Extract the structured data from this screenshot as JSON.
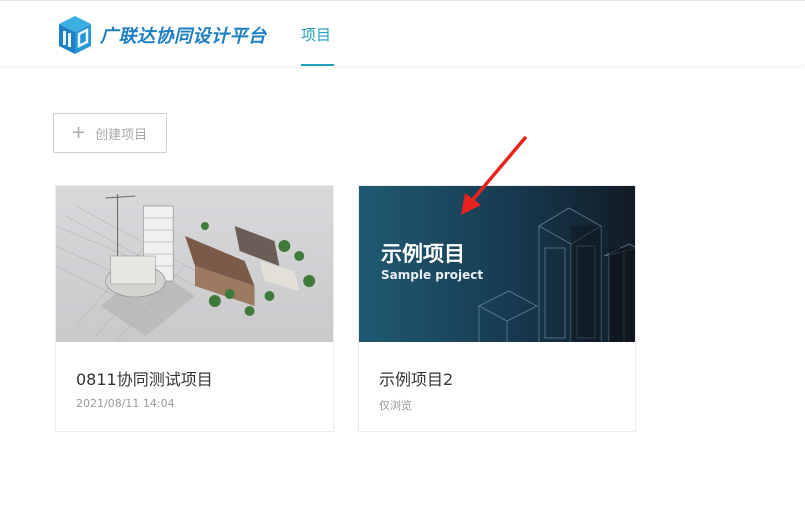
{
  "header": {
    "brand": "广联达协同设计平台",
    "nav_tab": "项目"
  },
  "toolbar": {
    "create_label": "创建项目"
  },
  "projects": [
    {
      "title": "0811协同测试项目",
      "meta": "2021/08/11 14:04"
    },
    {
      "title": "示例项目2",
      "meta": "仅浏览",
      "cover_title": "示例项目",
      "cover_subtitle": "Sample project"
    }
  ],
  "colors": {
    "accent": "#1fa2b8",
    "brand": "#1d7fc4",
    "annotation_arrow": "#e8231e"
  }
}
